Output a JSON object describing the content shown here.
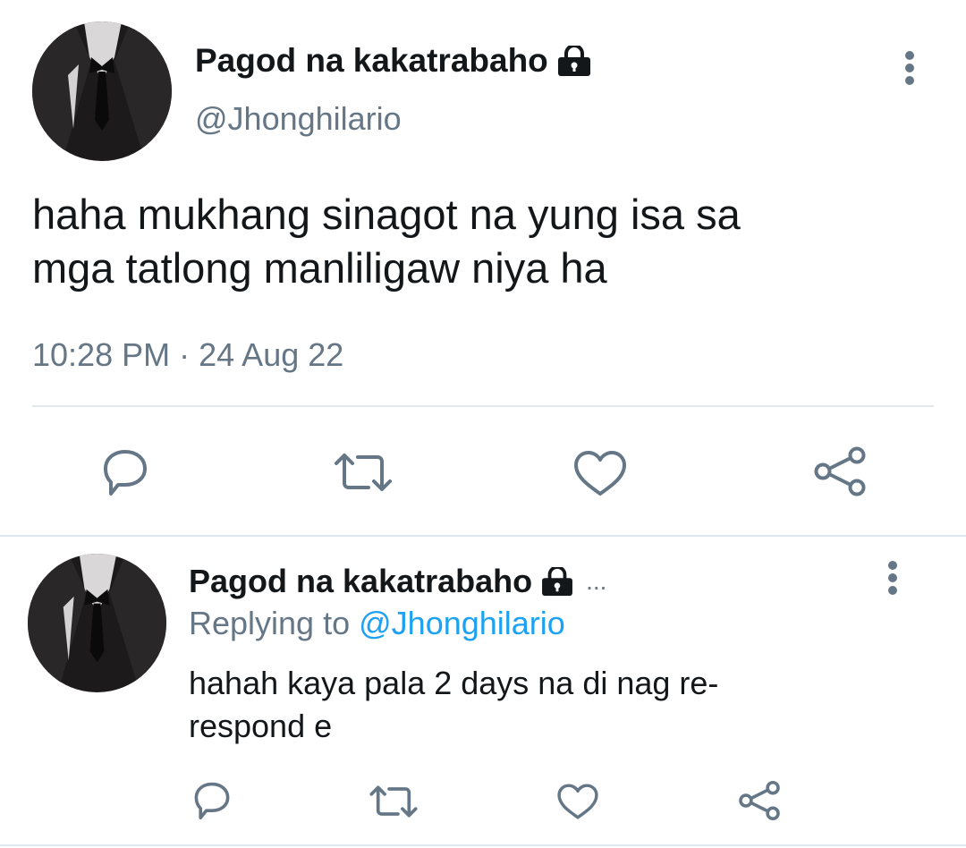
{
  "main_tweet": {
    "display_name": "Pagod na kakatrabaho",
    "handle": "@Jhonghilario",
    "text_line1": "haha mukhang sinagot na yung isa sa",
    "text_line2": "mga tatlong manliligaw niya ha",
    "time": "10:28 PM",
    "separator": "·",
    "date": "24 Aug 22"
  },
  "reply_tweet": {
    "display_name": "Pagod na kakatrabaho",
    "ellipsis": "...",
    "replying_prefix": "Replying to",
    "replying_handle": "@Jhonghilario",
    "text_line1": "hahah kaya pala 2 days na di nag re-",
    "text_line2": "respond e"
  },
  "icons": {
    "lock": "lock-icon",
    "more": "more-vertical-icon",
    "reply": "reply-icon",
    "retweet": "retweet-icon",
    "like": "heart-icon",
    "share": "share-icon"
  },
  "colors": {
    "text": "#14171a",
    "secondary": "#657786",
    "link": "#1da1f2",
    "divider": "#e1e8ed"
  }
}
